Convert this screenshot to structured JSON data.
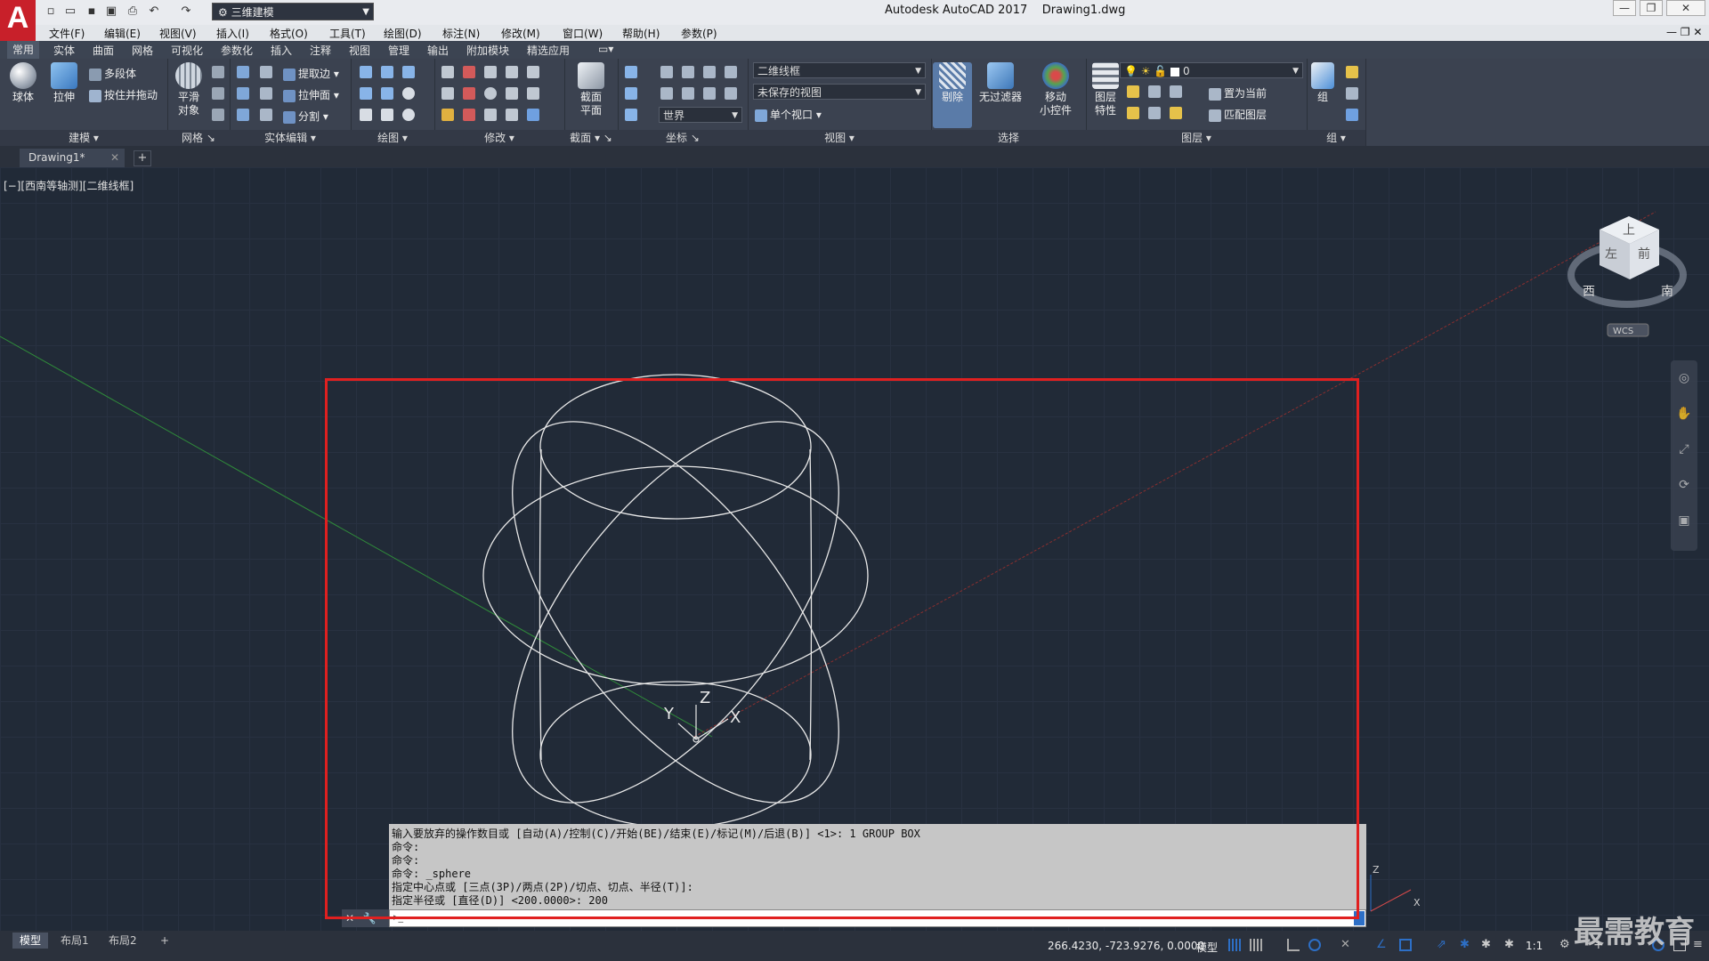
{
  "app": {
    "title": "Autodesk AutoCAD 2017",
    "document": "Drawing1.dwg",
    "logo_letter": "A",
    "workspace": "三维建模"
  },
  "menu": [
    "文件(F)",
    "编辑(E)",
    "视图(V)",
    "插入(I)",
    "格式(O)",
    "工具(T)",
    "绘图(D)",
    "标注(N)",
    "修改(M)",
    "窗口(W)",
    "帮助(H)",
    "参数(P)"
  ],
  "ribbon_tabs": [
    "常用",
    "实体",
    "曲面",
    "网格",
    "可视化",
    "参数化",
    "插入",
    "注释",
    "视图",
    "管理",
    "输出",
    "附加模块",
    "精选应用"
  ],
  "ribbon": {
    "modeling": {
      "title": "建模",
      "sphere": "球体",
      "extrude": "拉伸",
      "polysolid": "多段体",
      "presspull": "按住并拖动"
    },
    "mesh": {
      "title": "网格",
      "smooth": "平滑",
      "smooth2": "对象"
    },
    "solid_edit": {
      "title": "实体编辑",
      "extract": "提取边",
      "extrude_face": "拉伸面",
      "separate": "分割"
    },
    "draw": {
      "title": "绘图"
    },
    "modify": {
      "title": "修改"
    },
    "section": {
      "title": "截面",
      "plane": "截面",
      "plane2": "平面"
    },
    "coords": {
      "title": "坐标",
      "world": "世界"
    },
    "view": {
      "title": "视图",
      "visual_style": "二维线框",
      "saved_view": "未保存的视图",
      "viewport": "单个视口"
    },
    "selection": {
      "title": "选择",
      "cull": "剔除",
      "no_filter": "无过滤器",
      "gizmo": "移动",
      "gizmo2": "小控件"
    },
    "layers": {
      "title": "图层",
      "props": "图层",
      "props2": "特性",
      "layer_name": "0",
      "set_current": "置为当前",
      "match": "匹配图层"
    },
    "group": {
      "title": "组",
      "group": "组"
    }
  },
  "doc_tab": "Drawing1*",
  "viewport_label": "[−][西南等轴测][二维线框]",
  "viewcube": {
    "top": "上",
    "left": "左",
    "front": "前",
    "west": "西",
    "south": "南",
    "wcs": "WCS"
  },
  "ucs": {
    "x": "X",
    "y": "Y",
    "z": "Z"
  },
  "command_history": [
    "输入要放弃的操作数目或 [自动(A)/控制(C)/开始(BE)/结束(E)/标记(M)/后退(B)] <1>: 1 GROUP BOX",
    "命令:",
    "命令:",
    "命令: _sphere",
    "指定中心点或 [三点(3P)/两点(2P)/切点、切点、半径(T)]:",
    "指定半径或 [直径(D)] <200.0000>: 200"
  ],
  "layout_tabs": [
    "模型",
    "布局1",
    "布局2"
  ],
  "status": {
    "coords": "266.4230, -723.9276, 0.0000",
    "model": "模型",
    "scale": "1:1"
  },
  "watermark": "最需教育",
  "colors": {
    "accent": "#2d6fc6",
    "highlight": "#e02020",
    "logo": "#c8202a"
  }
}
